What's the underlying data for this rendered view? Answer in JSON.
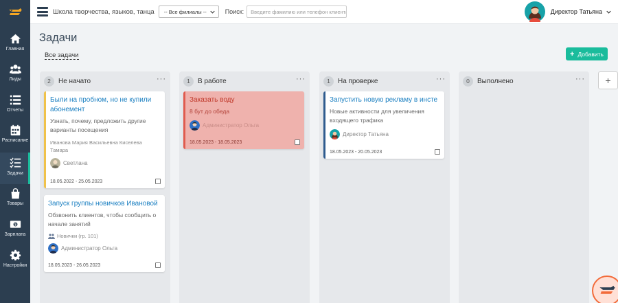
{
  "header": {
    "school_name": "Школа творчества, языков, танца",
    "branch_select": "-- Все филиалы --",
    "search_label": "Поиск:",
    "search_placeholder": "Введите фамилию или телефон клиента",
    "user_name": "Директор Татьяна"
  },
  "sidebar": {
    "items": [
      {
        "label": "Главная",
        "icon": "home-icon"
      },
      {
        "label": "Лиды",
        "icon": "users-icon"
      },
      {
        "label": "Отчеты",
        "icon": "list-icon"
      },
      {
        "label": "Расписание",
        "icon": "calendar-icon"
      },
      {
        "label": "Задачи",
        "icon": "tasks-icon",
        "active": true
      },
      {
        "label": "Товары",
        "icon": "bag-icon"
      },
      {
        "label": "Зарплата",
        "icon": "money-icon"
      },
      {
        "label": "Настройки",
        "icon": "gear-icon"
      }
    ]
  },
  "page": {
    "title": "Задачи",
    "filter_link": "Все задачи",
    "add_button": "Добавить",
    "add_column_icon": "+"
  },
  "columns": [
    {
      "count": "2",
      "title": "Не начато",
      "menu": "···"
    },
    {
      "count": "1",
      "title": "В работе",
      "menu": "···"
    },
    {
      "count": "1",
      "title": "На проверке",
      "menu": "···"
    },
    {
      "count": "0",
      "title": "Выполнено",
      "menu": "···"
    }
  ],
  "cards": [
    {
      "title": "Были на пробном, но не купили абонемент",
      "description": "Узнать, почему, предложить другие варианты посещения",
      "clients": "Иванова Мария Васильевна   Киселева Тамара",
      "assignee": "Светлана",
      "dates": "18.05.2022 - 25.05.2023",
      "accent": "#f0c24b"
    },
    {
      "title": "Запуск группы новичков Ивановой",
      "description": "Обзвонить клиентов, чтобы сообщить о начале занятий",
      "group": "Новички (гр. 101)",
      "assignee": "Администратор Ольга",
      "dates": "18.05.2023 - 26.05.2023"
    },
    {
      "title": "Заказать воду",
      "description": "8 бут до обеда",
      "assignee": "Администратор Ольга",
      "dates": "18.05.2023 - 18.05.2023",
      "accent": "#e05b4e"
    },
    {
      "title": "Запустить новую рекламу в инсте",
      "description": "Новые активности для увеличения входящего трафика",
      "assignee": "Директор Татьяна",
      "dates": "18.05.2023 - 20.05.2023",
      "accent": "#2f5c8f"
    }
  ],
  "colors": {
    "sidebar": "#2c3e50",
    "accent": "#1abc9c",
    "link": "#1a7fc1"
  }
}
